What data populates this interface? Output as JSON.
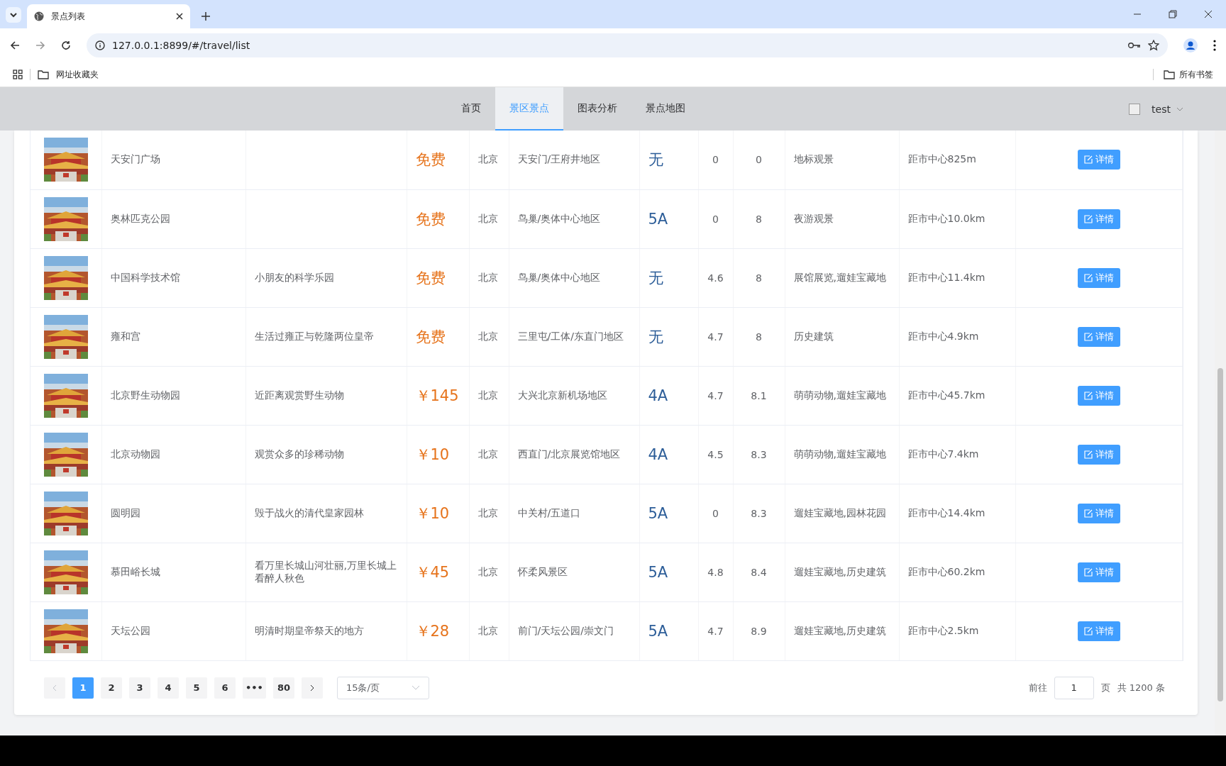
{
  "browser": {
    "tab_title": "景点列表",
    "url": "127.0.0.1:8899/#/travel/list",
    "bookmark_folder": "网址收藏夹",
    "all_bookmarks": "所有书签"
  },
  "nav": {
    "items": [
      {
        "label": "首页",
        "selected": false
      },
      {
        "label": "景区景点",
        "selected": true
      },
      {
        "label": "图表分析",
        "selected": false
      },
      {
        "label": "景点地图",
        "selected": false
      }
    ],
    "user": "test"
  },
  "table": {
    "rows": [
      {
        "name": "天安门广场",
        "desc": "",
        "price": "免费",
        "city": "北京",
        "area": "天安门/王府井地区",
        "level": "无",
        "score": "0",
        "hot": "0",
        "tags": "地标观景",
        "distance": "距市中心825m",
        "action": "详情"
      },
      {
        "name": "奥林匹克公园",
        "desc": "",
        "price": "免费",
        "city": "北京",
        "area": "鸟巢/奥体中心地区",
        "level": "5A",
        "score": "0",
        "hot": "8",
        "tags": "夜游观景",
        "distance": "距市中心10.0km",
        "action": "详情"
      },
      {
        "name": "中国科学技术馆",
        "desc": "小朋友的科学乐园",
        "price": "免费",
        "city": "北京",
        "area": "鸟巢/奥体中心地区",
        "level": "无",
        "score": "4.6",
        "hot": "8",
        "tags": "展馆展览,遛娃宝藏地",
        "distance": "距市中心11.4km",
        "action": "详情"
      },
      {
        "name": "雍和宫",
        "desc": "生活过雍正与乾隆两位皇帝",
        "price": "免费",
        "city": "北京",
        "area": "三里屯/工体/东直门地区",
        "level": "无",
        "score": "4.7",
        "hot": "8",
        "tags": "历史建筑",
        "distance": "距市中心4.9km",
        "action": "详情"
      },
      {
        "name": "北京野生动物园",
        "desc": "近距离观赏野生动物",
        "price": "￥145",
        "city": "北京",
        "area": "大兴北京新机场地区",
        "level": "4A",
        "score": "4.7",
        "hot": "8.1",
        "tags": "萌萌动物,遛娃宝藏地",
        "distance": "距市中心45.7km",
        "action": "详情"
      },
      {
        "name": "北京动物园",
        "desc": "观赏众多的珍稀动物",
        "price": "￥10",
        "city": "北京",
        "area": "西直门/北京展览馆地区",
        "level": "4A",
        "score": "4.5",
        "hot": "8.3",
        "tags": "萌萌动物,遛娃宝藏地",
        "distance": "距市中心7.4km",
        "action": "详情"
      },
      {
        "name": "圆明园",
        "desc": "毁于战火的清代皇家园林",
        "price": "￥10",
        "city": "北京",
        "area": "中关村/五道口",
        "level": "5A",
        "score": "0",
        "hot": "8.3",
        "tags": "遛娃宝藏地,园林花园",
        "distance": "距市中心14.4km",
        "action": "详情"
      },
      {
        "name": "慕田峪长城",
        "desc": "看万里长城山河壮丽,万里长城上看醉人秋色",
        "price": "￥45",
        "city": "北京",
        "area": "怀柔风景区",
        "level": "5A",
        "score": "4.8",
        "hot": "8.4",
        "tags": "遛娃宝藏地,历史建筑",
        "distance": "距市中心60.2km",
        "action": "详情"
      },
      {
        "name": "天坛公园",
        "desc": "明清时期皇帝祭天的地方",
        "price": "￥28",
        "city": "北京",
        "area": "前门/天坛公园/崇文门",
        "level": "5A",
        "score": "4.7",
        "hot": "8.9",
        "tags": "遛娃宝藏地,历史建筑",
        "distance": "距市中心2.5km",
        "action": "详情"
      }
    ]
  },
  "pagination": {
    "prev_disabled": true,
    "pages": [
      {
        "label": "1",
        "selected": true
      },
      {
        "label": "2",
        "selected": false
      },
      {
        "label": "3",
        "selected": false
      },
      {
        "label": "4",
        "selected": false
      },
      {
        "label": "5",
        "selected": false
      },
      {
        "label": "6",
        "selected": false
      },
      {
        "label": "•••",
        "selected": false
      },
      {
        "label": "80",
        "selected": false
      }
    ],
    "per_page": "15条/页",
    "goto": "前往",
    "page_input": "1",
    "page_unit": "页",
    "total": "共 1200 条"
  }
}
